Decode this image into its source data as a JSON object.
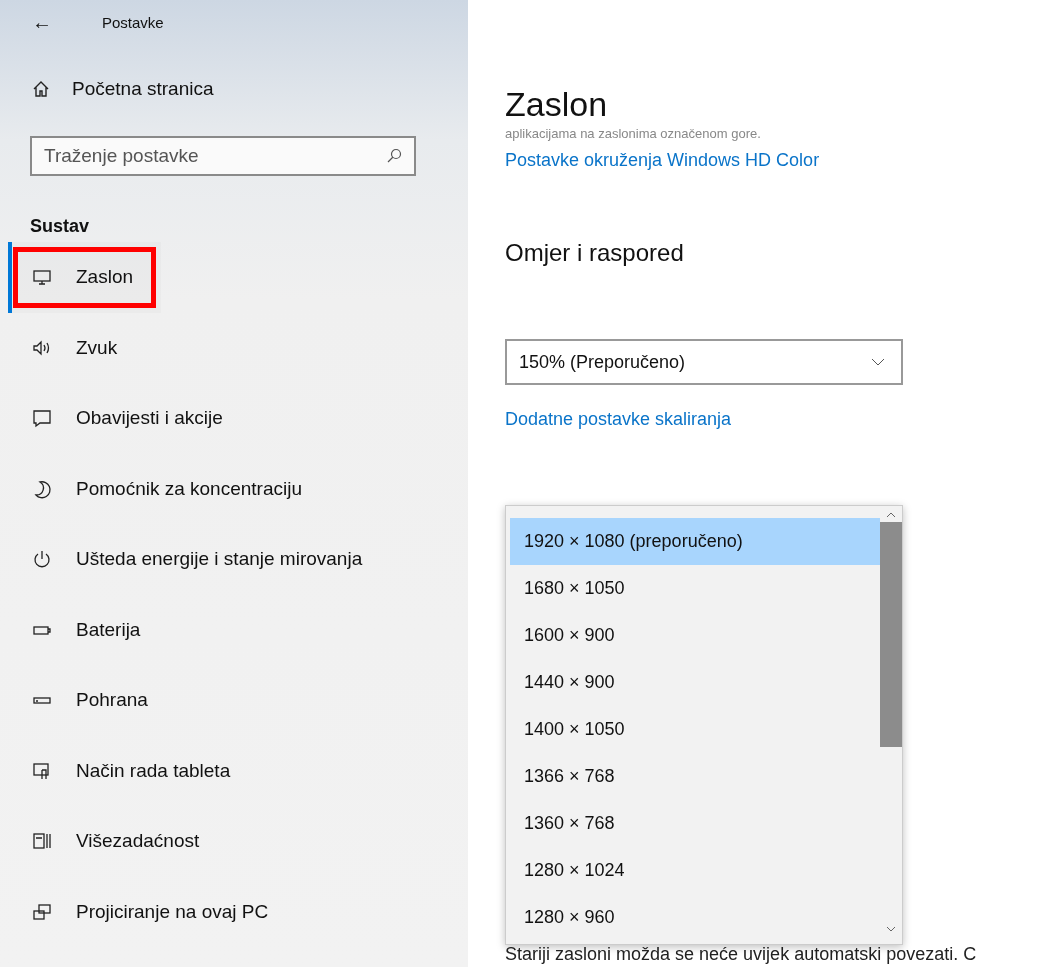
{
  "header": {
    "back": "←",
    "title": "Postavke"
  },
  "sidebar": {
    "home": "Početna stranica",
    "search": {
      "placeholder": "Traženje postavke"
    },
    "section": "Sustav",
    "items": [
      {
        "label": "Zaslon",
        "selected": true,
        "annotated": true
      },
      {
        "label": "Zvuk",
        "selected": false,
        "annotated": false
      },
      {
        "label": "Obavijesti i akcije",
        "selected": false,
        "annotated": false
      },
      {
        "label": "Pomoćnik za koncentraciju",
        "selected": false,
        "annotated": false
      },
      {
        "label": "Ušteda energije i stanje mirovanja",
        "selected": false,
        "annotated": false
      },
      {
        "label": "Baterija",
        "selected": false,
        "annotated": false
      },
      {
        "label": "Pohrana",
        "selected": false,
        "annotated": false
      },
      {
        "label": "Način rada tableta",
        "selected": false,
        "annotated": false
      },
      {
        "label": "Višezadaćnost",
        "selected": false,
        "annotated": false
      },
      {
        "label": "Projiciranje na ovaj PC",
        "selected": false,
        "annotated": false
      }
    ]
  },
  "main": {
    "title": "Zaslon",
    "cut_text": "aplikacijama na zaslonima označenom gore.",
    "hd_link": "Postavke okruženja Windows HD Color",
    "section": "Omjer i raspored",
    "scale_dropdown": {
      "value": "150% (Preporučeno)"
    },
    "scale_link": "Dodatne postavke skaliranja",
    "resolution_list": [
      {
        "label": "1920 × 1080 (preporučeno)",
        "selected": true
      },
      {
        "label": "1680 × 1050",
        "selected": false
      },
      {
        "label": "1600 × 900",
        "selected": false
      },
      {
        "label": "1440 × 900",
        "selected": false
      },
      {
        "label": "1400 × 1050",
        "selected": false
      },
      {
        "label": "1366 × 768",
        "selected": false
      },
      {
        "label": "1360 × 768",
        "selected": false
      },
      {
        "label": "1280 × 1024",
        "selected": false
      },
      {
        "label": "1280 × 960",
        "selected": false
      }
    ],
    "bottom_text": "Stariji zasloni možda se neće uvijek automatski povezati. C"
  }
}
